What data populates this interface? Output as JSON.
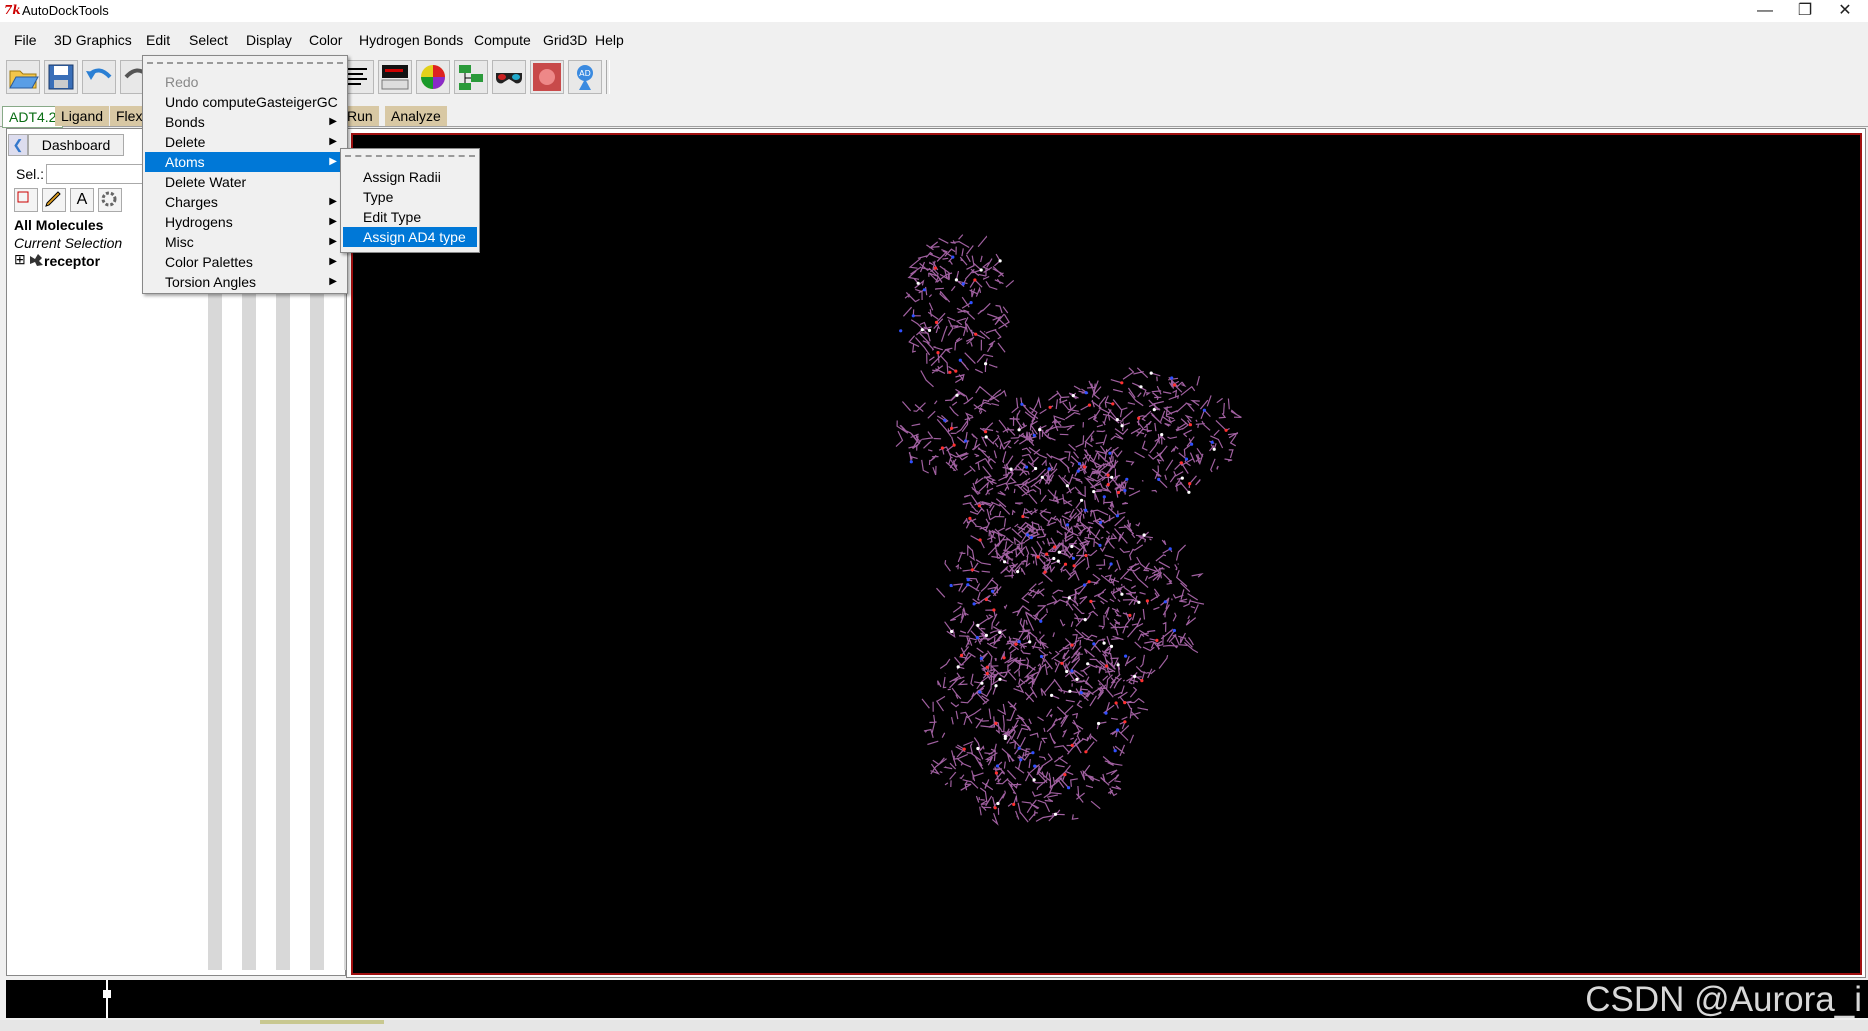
{
  "window": {
    "title": "AutoDockTools",
    "tk_logo": "7k",
    "controls": [
      "—",
      "❐",
      "✕"
    ]
  },
  "menubar": [
    "File",
    "3D Graphics",
    "Edit",
    "Select",
    "Display",
    "Color",
    "Hydrogen Bonds",
    "Compute",
    "Grid3D",
    "Help"
  ],
  "toolbar_icons": [
    "open-icon",
    "save-icon",
    "undo-icon",
    "redo-icon",
    "text-icon",
    "console-icon",
    "color-sphere-icon",
    "network-icon",
    "stereo-glasses-icon",
    "camera-icon",
    "autodock-icon"
  ],
  "tabs": {
    "version": "ADT4.2",
    "items": [
      "Ligand",
      "Flex",
      "Run",
      "Analyze"
    ]
  },
  "left_panel": {
    "dashboard_label": "Dashboard",
    "sel_label": "Sel.:",
    "all_molecules": "All Molecules",
    "current_selection": "Current Selection",
    "tree_expand": "⊞",
    "molecule_name": "receptor"
  },
  "edit_menu": {
    "items": [
      {
        "label": "Redo",
        "disabled": true
      },
      {
        "label": "Undo computeGasteigerGC"
      },
      {
        "label": "Bonds",
        "submenu": true
      },
      {
        "label": "Delete",
        "submenu": true
      },
      {
        "label": "Atoms",
        "submenu": true,
        "highlighted": true
      },
      {
        "label": "Delete Water"
      },
      {
        "label": "Charges",
        "submenu": true
      },
      {
        "label": "Hydrogens",
        "submenu": true
      },
      {
        "label": "Misc",
        "submenu": true
      },
      {
        "label": "Color Palettes",
        "submenu": true
      },
      {
        "label": "Torsion Angles",
        "submenu": true
      }
    ],
    "arrow": "▶"
  },
  "atoms_submenu": {
    "items": [
      {
        "label": "Assign Radii"
      },
      {
        "label": "Type"
      },
      {
        "label": "Edit Type"
      },
      {
        "label": "Assign AD4 type",
        "highlighted": true
      }
    ]
  },
  "watermark": "CSDN @Aurora_i",
  "colors": {
    "accent": "#0078d7",
    "viewer_border": "#a01010",
    "molecule": "#c878c8"
  }
}
